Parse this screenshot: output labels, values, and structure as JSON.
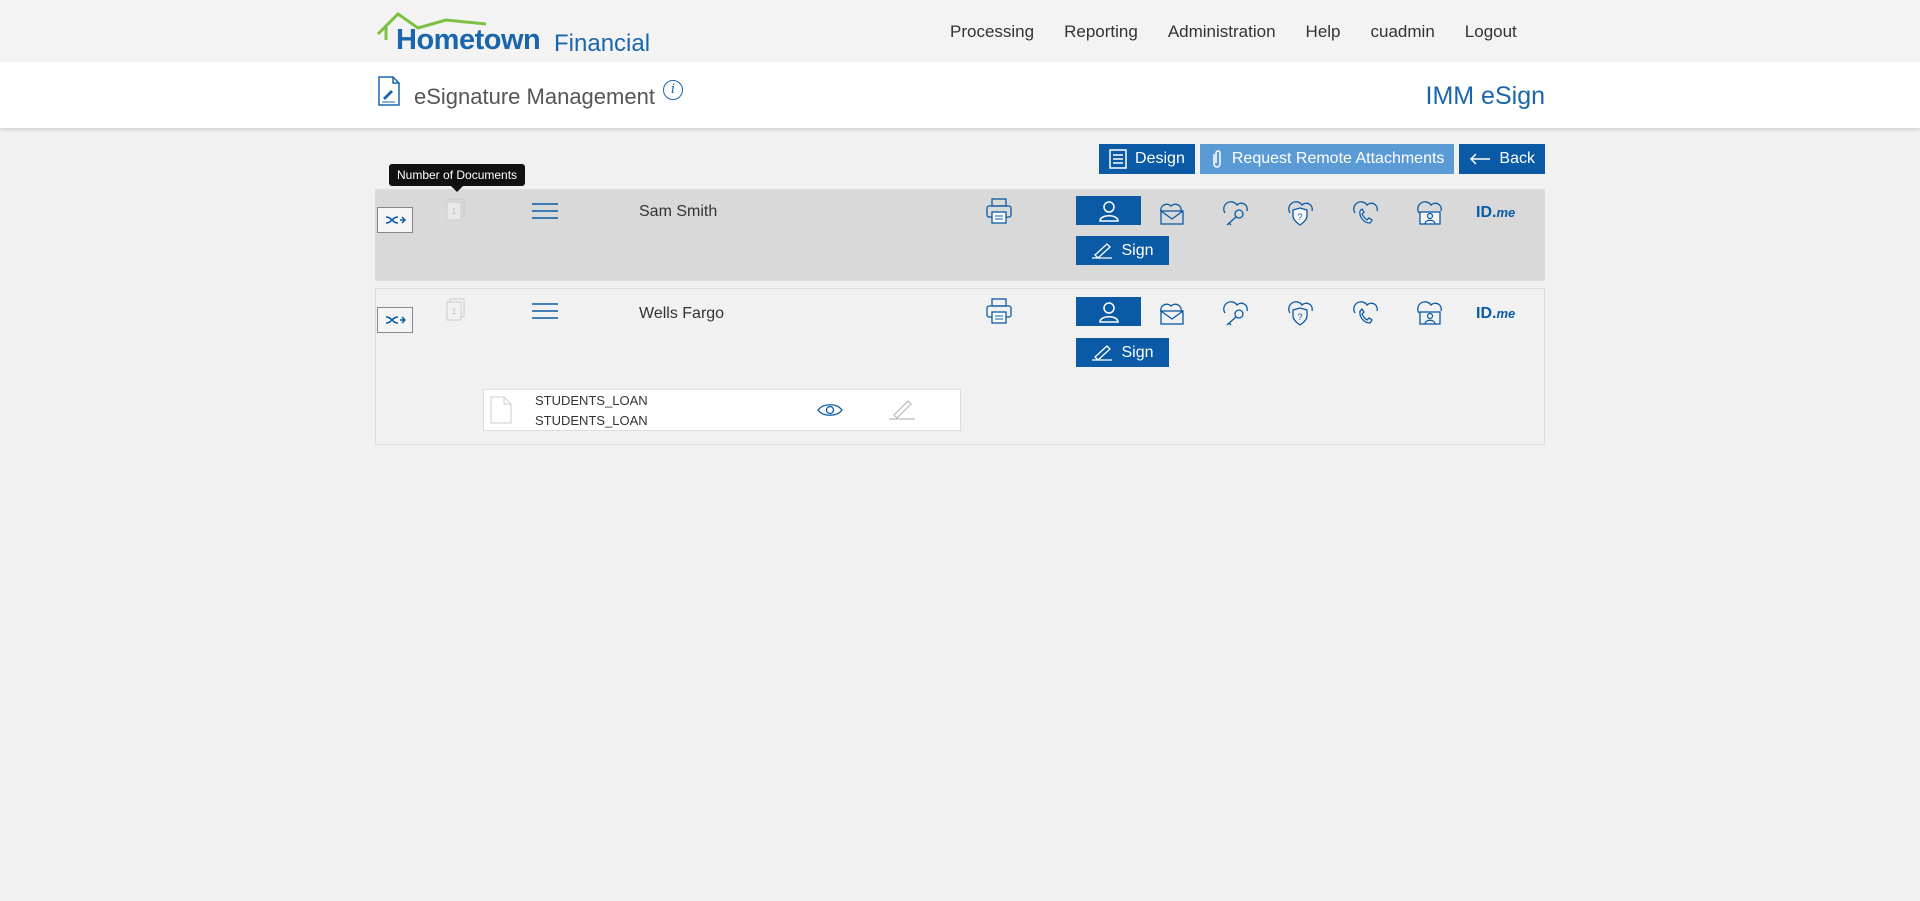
{
  "header": {
    "brand_main": "Hometown",
    "brand_sub": "Financial",
    "nav": [
      "Processing",
      "Reporting",
      "Administration",
      "Help",
      "cuadmin",
      "Logout"
    ]
  },
  "titlebar": {
    "title": "eSignature Management",
    "info_icon": "i",
    "app_name": "IMM eSign"
  },
  "actions": {
    "design_label": "Design",
    "attachments_label": "Request Remote Attachments",
    "back_label": "Back"
  },
  "tooltip": "Number of Documents",
  "signers": [
    {
      "name": "Sam Smith",
      "doc_count": "1",
      "sign_label": "Sign",
      "idme_label": "ID.",
      "idme_suffix": "me"
    },
    {
      "name": "Wells Fargo",
      "doc_count": "1",
      "sign_label": "Sign",
      "idme_label": "ID.",
      "idme_suffix": "me",
      "documents": [
        {
          "line1": "STUDENTS_LOAN",
          "line2": "STUDENTS_LOAN"
        }
      ]
    }
  ],
  "colors": {
    "primary": "#0b5aa5",
    "accent_light": "#5b9bd5",
    "logo_green": "#7dc142"
  }
}
